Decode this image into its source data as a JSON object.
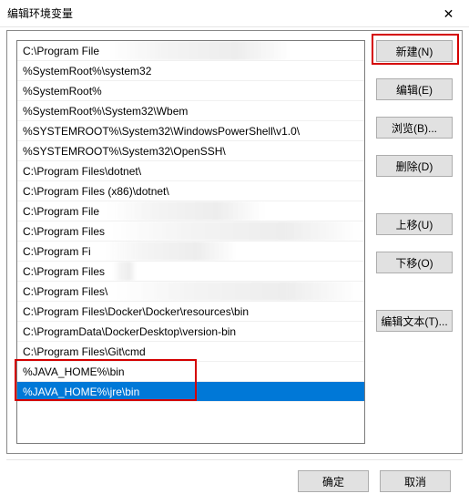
{
  "window": {
    "title": "编辑环境变量",
    "close_glyph": "✕"
  },
  "list": {
    "items": [
      {
        "text": "C:\\Program File",
        "blur_from": 100,
        "blur_to": 320
      },
      {
        "text": "%SystemRoot%\\system32"
      },
      {
        "text": "%SystemRoot%"
      },
      {
        "text": "%SystemRoot%\\System32\\Wbem"
      },
      {
        "text": "%SYSTEMROOT%\\System32\\WindowsPowerShell\\v1.0\\"
      },
      {
        "text": "%SYSTEMROOT%\\System32\\OpenSSH\\"
      },
      {
        "text": "C:\\Program Files\\dotnet\\"
      },
      {
        "text": "C:\\Program Files (x86)\\dotnet\\"
      },
      {
        "text": "C:\\Program File",
        "blur_from": 100,
        "blur_to": 290
      },
      {
        "text": "C:\\Program Files",
        "blur_from": 103,
        "blur_to": 395
      },
      {
        "text": "C:\\Program Fi",
        "blur_from": 95,
        "blur_to": 260
      },
      {
        "text": "C:\\Program Files",
        "blur_from": 105,
        "blur_to": 150
      },
      {
        "text": "C:\\Program Files\\",
        "blur_from": 108,
        "blur_to": 395
      },
      {
        "text": "C:\\Program Files\\Docker\\Docker\\resources\\bin"
      },
      {
        "text": "C:\\ProgramData\\DockerDesktop\\version-bin"
      },
      {
        "text": "C:\\Program Files\\Git\\cmd"
      },
      {
        "text": "%JAVA_HOME%\\bin"
      },
      {
        "text": "%JAVA_HOME%\\jre\\bin",
        "selected": true
      }
    ]
  },
  "buttons": {
    "new": "新建(N)",
    "edit": "编辑(E)",
    "browse": "浏览(B)...",
    "delete": "删除(D)",
    "moveup": "上移(U)",
    "movedown": "下移(O)",
    "edittext": "编辑文本(T)...",
    "ok": "确定",
    "cancel": "取消"
  }
}
